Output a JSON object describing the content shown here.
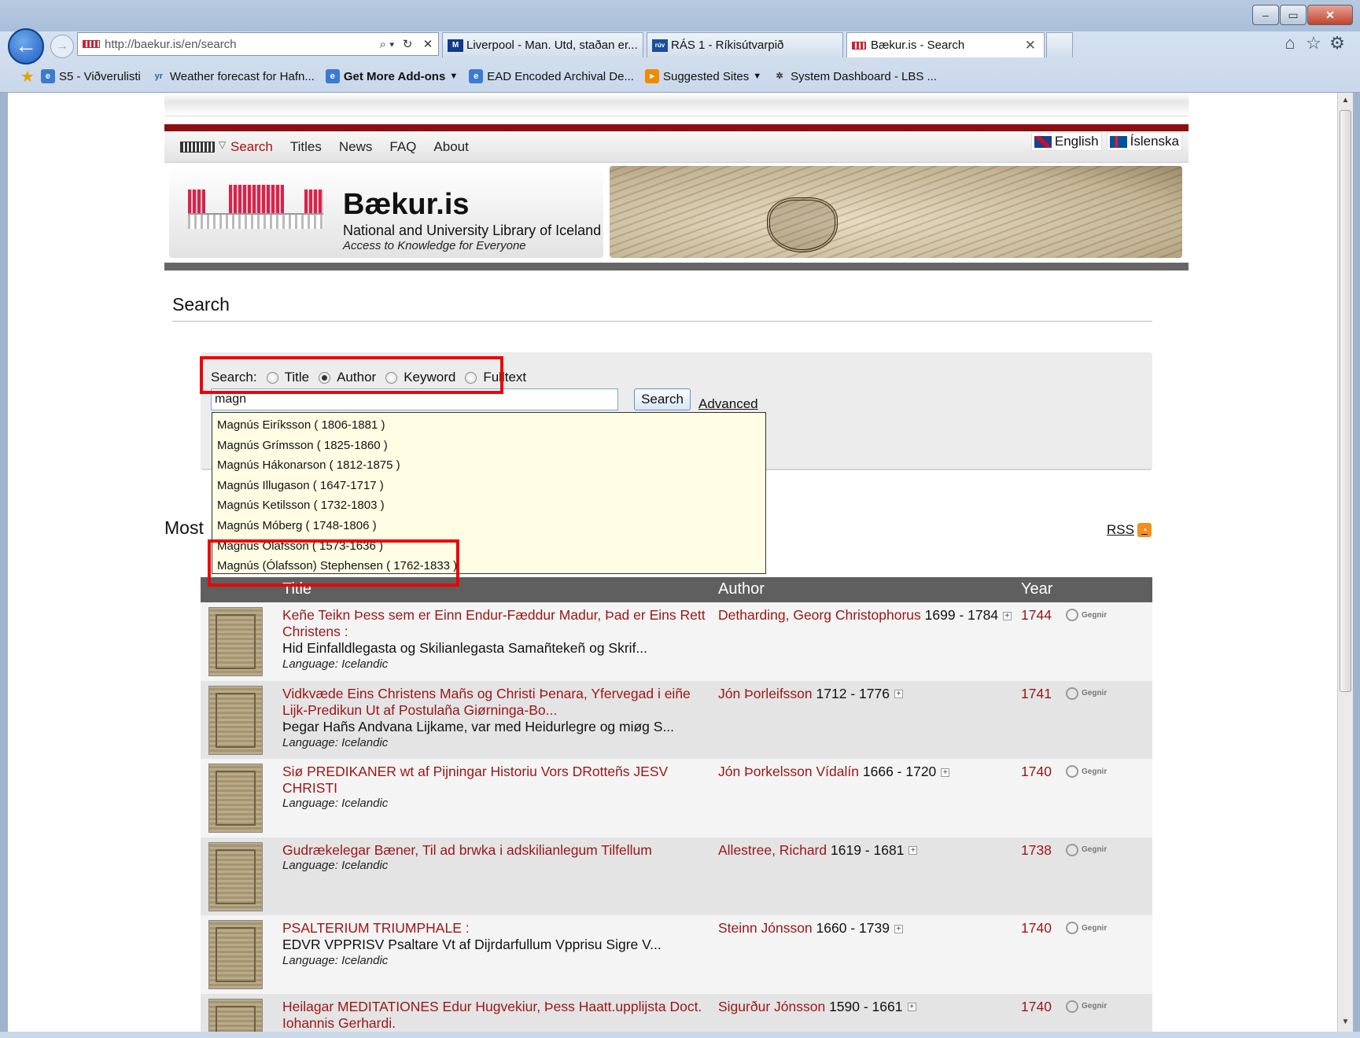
{
  "browser": {
    "address_url": "http://baekur.is/en/search",
    "address_icons": [
      "⌕ ▾",
      "↻",
      "✕"
    ],
    "tabs": [
      {
        "label": "Liverpool - Man. Utd, staðan er...",
        "icon": "mbl-icon"
      },
      {
        "label": "RÁS 1 - Ríkisútvarpið",
        "icon": "ruv-icon"
      },
      {
        "label": "Bækur.is - Search",
        "icon": "baekur-icon"
      }
    ],
    "favorites": [
      {
        "label": "S5 - Viðverulisti",
        "icon": "ie-page-icon"
      },
      {
        "label": "Weather forecast for Hafn...",
        "icon": "yr-icon"
      },
      {
        "label": "Get More Add-ons",
        "icon": "ie-page-icon"
      },
      {
        "label": "EAD Encoded Archival De...",
        "icon": "ie-page-icon"
      },
      {
        "label": "Suggested Sites",
        "icon": "suggested-icon"
      },
      {
        "label": "System Dashboard - LBS ...",
        "icon": "jira-icon"
      }
    ]
  },
  "site": {
    "nav": [
      "Search",
      "Titles",
      "News",
      "FAQ",
      "About"
    ],
    "lang": [
      "English",
      "Íslenska"
    ],
    "brand_name": "Bækur.is",
    "brand_sub": "National and University Library of Iceland",
    "brand_tag": "Access to Knowledge for Everyone"
  },
  "search": {
    "heading": "Search",
    "label": "Search:",
    "options": [
      "Title",
      "Author",
      "Keyword",
      "Fulltext"
    ],
    "selected": "Author",
    "input_value": "magn",
    "button": "Search",
    "advanced": "Advanced",
    "suggestions": [
      "Magnús Eiríksson ( 1806-1881 )",
      "Magnús Grímsson ( 1825-1860 )",
      "Magnús Hákonarson ( 1812-1875 )",
      "Magnús Illugason ( 1647-1717 )",
      "Magnús Ketilsson ( 1732-1803 )",
      "Magnús Móberg ( 1748-1806 )",
      "Magnús Ólafsson ( 1573-1636 )",
      "Magnús (Ólafsson) Stephensen ( 1762-1833 )"
    ]
  },
  "results": {
    "heading": "Most",
    "rss": "RSS",
    "columns": [
      "Title",
      "Author",
      "Year"
    ],
    "gegnir": "Gegnir",
    "rows": [
      {
        "title": "Keñe Teikn Þess sem er Einn Endur-Fæddur Madur, Þad er Eins Rett Christens :",
        "sub": "Hid Einfalldlegasta og Skilianlegasta Samañtekeñ og Skrif...",
        "lang": "Language: Icelandic",
        "author": "Detharding, Georg Christophorus",
        "life": "1699 - 1784",
        "year": "1744"
      },
      {
        "title": "Vidkvæde Eins Christens Mañs og Christi Þenara, Yfervegad i eiñe Lijk-Predikun Ut af Postulaña Giørninga-Bo...",
        "sub": "Þegar Hañs Andvana Lijkame, var med Heidurlegre og miøg S...",
        "lang": "Language: Icelandic",
        "author": "Jón Þorleifsson",
        "life": "1712 - 1776",
        "year": "1741"
      },
      {
        "title": "Siø PREDIKANER wt af Pijningar Historiu Vors DRotteñs JESV CHRISTI",
        "sub": "",
        "lang": "Language: Icelandic",
        "author": "Jón Þorkelsson Vídalín",
        "life": "1666 - 1720",
        "year": "1740"
      },
      {
        "title": "Gudrækelegar Bæner, Til ad brwka i adskilianlegum Tilfellum",
        "sub": "",
        "lang": "Language: Icelandic",
        "author": "Allestree, Richard",
        "life": "1619 - 1681",
        "year": "1738"
      },
      {
        "title": "PSALTERIUM TRIUMPHALE :",
        "sub": "EDVR VPPRISV Psaltare Vt af Dijrdarfullum Vpprisu Sigre V...",
        "lang": "Language: Icelandic",
        "author": "Steinn Jónsson",
        "life": "1660 - 1739",
        "year": "1740"
      },
      {
        "title": "Heilagar MEDITATIONES Edur Hugvekiur, Þess Haatt.upplijsta Doct. Iohannis Gerhardi.",
        "sub": "",
        "lang": "",
        "author": "Sigurður Jónsson",
        "life": "1590 - 1661",
        "year": "1740"
      }
    ]
  }
}
